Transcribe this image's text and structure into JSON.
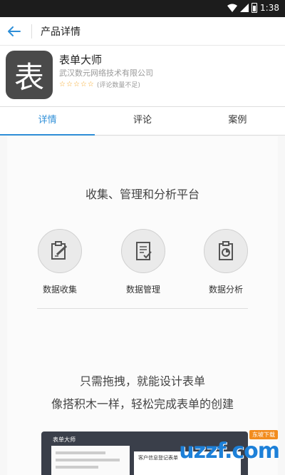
{
  "status_bar": {
    "time": "1:38"
  },
  "app_bar": {
    "title": "产品详情"
  },
  "app": {
    "logo_char": "表",
    "name": "表单大师",
    "company": "武汉数元网络技术有限公司",
    "rating_text": "(评论数量不足)",
    "stars": 5
  },
  "tabs": [
    {
      "label": "详情",
      "active": true
    },
    {
      "label": "评论",
      "active": false
    },
    {
      "label": "案例",
      "active": false
    }
  ],
  "detail": {
    "headline": "收集、管理和分析平台",
    "features": [
      {
        "label": "数据收集",
        "icon": "form-edit-icon"
      },
      {
        "label": "数据管理",
        "icon": "document-check-icon"
      },
      {
        "label": "数据分析",
        "icon": "clipboard-chart-icon"
      }
    ],
    "tagline_1": "只需拖拽，就能设计表单",
    "tagline_2": "像搭积木一样，轻松完成表单的创建",
    "preview": {
      "title": "表单大师",
      "panel_title": "客户信息登记表单"
    }
  },
  "watermark": {
    "text": "uzzf.com",
    "badge": "东坡下载"
  },
  "colors": {
    "accent": "#2f8fd8",
    "star": "#f5a623",
    "logo_bg": "#4a4a4a"
  }
}
